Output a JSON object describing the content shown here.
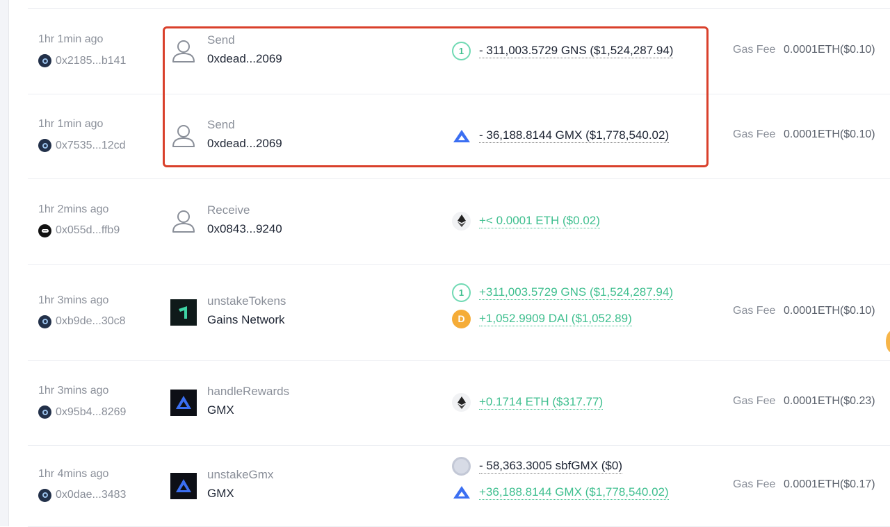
{
  "gas_label": "Gas Fee",
  "rows": [
    {
      "time": "1hr 1min ago",
      "hash": "0x2185...b141",
      "chain": "arbitrum",
      "icon": "user",
      "type": "Send",
      "name": "0xdead...2069",
      "tokens": [
        {
          "icon": "gns",
          "amount": "- 311,003.5729 GNS ($1,524,287.94)",
          "sign": "neg"
        }
      ],
      "gas": "0.0001ETH($0.10)"
    },
    {
      "time": "1hr 1min ago",
      "hash": "0x7535...12cd",
      "chain": "arbitrum",
      "icon": "user",
      "type": "Send",
      "name": "0xdead...2069",
      "tokens": [
        {
          "icon": "gmx",
          "amount": "- 36,188.8144 GMX ($1,778,540.02)",
          "sign": "neg"
        }
      ],
      "gas": "0.0001ETH($0.10)"
    },
    {
      "time": "1hr 2mins ago",
      "hash": "0x055d...ffb9",
      "chain": "other",
      "icon": "user",
      "type": "Receive",
      "name": "0x0843...9240",
      "tokens": [
        {
          "icon": "eth",
          "amount": "+< 0.0001 ETH ($0.02)",
          "sign": "pos"
        }
      ],
      "gas": null
    },
    {
      "time": "1hr 3mins ago",
      "hash": "0xb9de...30c8",
      "chain": "arbitrum",
      "icon": "gains",
      "type": "unstakeTokens",
      "name": "Gains Network",
      "tokens": [
        {
          "icon": "gns",
          "amount": "+311,003.5729 GNS ($1,524,287.94)",
          "sign": "pos"
        },
        {
          "icon": "dai",
          "amount": "+1,052.9909 DAI ($1,052.89)",
          "sign": "pos"
        }
      ],
      "gas": "0.0001ETH($0.10)"
    },
    {
      "time": "1hr 3mins ago",
      "hash": "0x95b4...8269",
      "chain": "arbitrum",
      "icon": "gmxapp",
      "type": "handleRewards",
      "name": "GMX",
      "tokens": [
        {
          "icon": "eth",
          "amount": "+0.1714 ETH ($317.77)",
          "sign": "pos"
        }
      ],
      "gas": "0.0001ETH($0.23)"
    },
    {
      "time": "1hr 4mins ago",
      "hash": "0x0dae...3483",
      "chain": "arbitrum",
      "icon": "gmxapp",
      "type": "unstakeGmx",
      "name": "GMX",
      "tokens": [
        {
          "icon": "sbfgmx",
          "amount": "- 58,363.3005 sbfGMX ($0)",
          "sign": "neg"
        },
        {
          "icon": "gmx",
          "amount": "+36,188.8144 GMX ($1,778,540.02)",
          "sign": "pos"
        }
      ],
      "gas": "0.0001ETH($0.17)"
    }
  ],
  "colors": {
    "positive": "#3fbf8f",
    "highlight": "#d9402b"
  }
}
